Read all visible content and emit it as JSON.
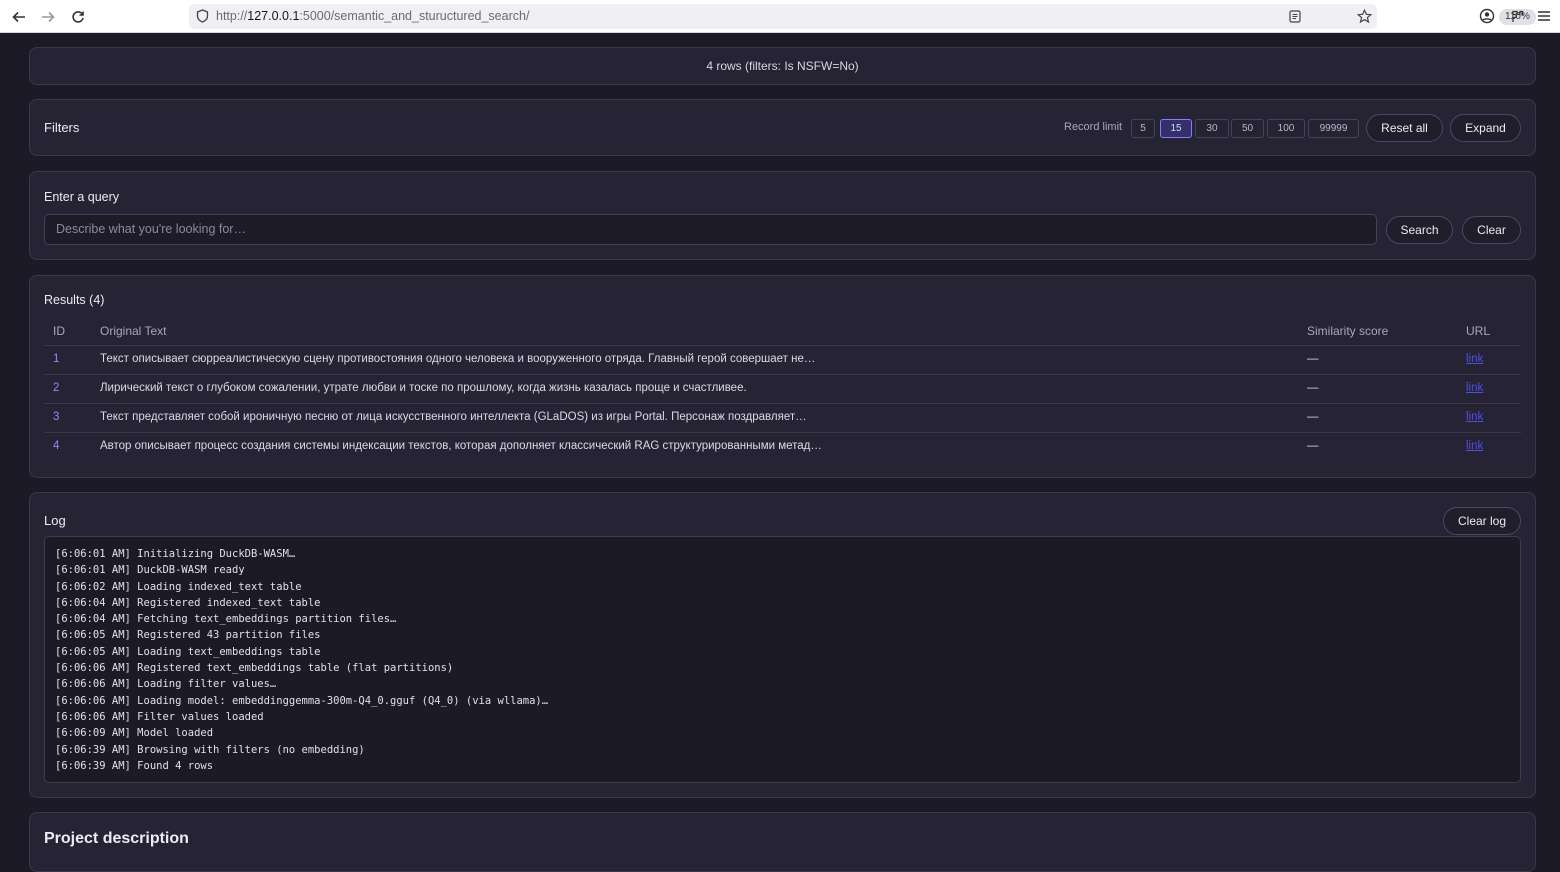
{
  "browser": {
    "url_prefix": "http://",
    "url_host": "127.0.0.1",
    "url_path": ":5000/semantic_and_stuructured_search/",
    "zoom": "110%",
    "icons": [
      "back-arrow-icon",
      "forward-arrow-icon",
      "reload-icon",
      "shield-icon",
      "reader-mode-icon",
      "bookmark-star-icon",
      "account-icon",
      "extensions-icon",
      "menu-icon"
    ]
  },
  "status": {
    "text": "4 rows (filters: Is NSFW=No)"
  },
  "filters": {
    "title": "Filters",
    "record_limit_label": "Record limit",
    "limits": [
      "5",
      "15",
      "30",
      "50",
      "100",
      "99999"
    ],
    "active_limit": "15",
    "reset_all_label": "Reset all",
    "expand_label": "Expand"
  },
  "query": {
    "label": "Enter a query",
    "placeholder": "Describe what you're looking for…",
    "search_label": "Search",
    "clear_label": "Clear"
  },
  "results": {
    "title": "Results (4)",
    "columns": [
      "ID",
      "Original Text",
      "Similarity score",
      "URL"
    ],
    "rows": [
      {
        "id": "1",
        "text": "Текст описывает сюрреалистическую сцену противостояния одного человека и вооруженного отряда. Главный герой совершает не…",
        "score": "—",
        "url": "link"
      },
      {
        "id": "2",
        "text": "Лирический текст о глубоком сожалении, утрате любви и тоске по прошлому, когда жизнь казалась проще и счастливее.",
        "score": "—",
        "url": "link"
      },
      {
        "id": "3",
        "text": "Текст представляет собой ироничную песню от лица искусственного интеллекта (GLaDOS) из игры Portal. Персонаж поздравляет…",
        "score": "—",
        "url": "link"
      },
      {
        "id": "4",
        "text": "Автор описывает процесс создания системы индексации текстов, которая дополняет классический RAG структурированными метад…",
        "score": "—",
        "url": "link"
      }
    ]
  },
  "log": {
    "title": "Log",
    "clear_label": "Clear log",
    "lines": [
      "[6:06:01 AM] Initializing DuckDB-WASM…",
      "[6:06:01 AM] DuckDB-WASM ready",
      "[6:06:02 AM] Loading indexed_text table",
      "[6:06:04 AM] Registered indexed_text table",
      "[6:06:04 AM] Fetching text_embeddings partition files…",
      "[6:06:05 AM] Registered 43 partition files",
      "[6:06:05 AM] Loading text_embeddings table",
      "[6:06:06 AM] Registered text_embeddings table (flat partitions)",
      "[6:06:06 AM] Loading filter values…",
      "[6:06:06 AM] Loading model: embeddinggemma-300m-Q4_0.gguf (Q4_0) (via wllama)…",
      "[6:06:06 AM] Filter values loaded",
      "[6:06:09 AM] Model loaded",
      "[6:06:39 AM] Browsing with filters (no embedding)",
      "[6:06:39 AM] Found 4 rows"
    ]
  },
  "project": {
    "title": "Project description"
  },
  "colors": {
    "page_bg": "#1b1a26",
    "card_bg": "#262434",
    "accent": "#8a7cff",
    "link": "#4e4ee8"
  }
}
